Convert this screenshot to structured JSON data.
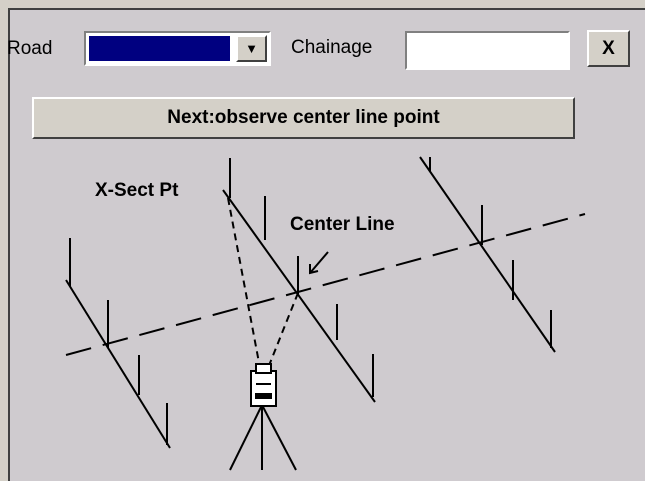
{
  "road": {
    "label": "Road",
    "selected_value": ""
  },
  "chainage": {
    "label": "Chainage",
    "value": ""
  },
  "close_button": {
    "label": "X"
  },
  "next_button": {
    "label": "Next:observe center line point"
  },
  "diagram": {
    "xsect_label": "X-Sect Pt",
    "centerline_label": "Center Line"
  },
  "colors": {
    "selection": "#000080",
    "panel": "#cfcbcf"
  },
  "icons": {
    "combo_arrow": "chevron-down-icon",
    "instrument": "total-station-icon"
  }
}
